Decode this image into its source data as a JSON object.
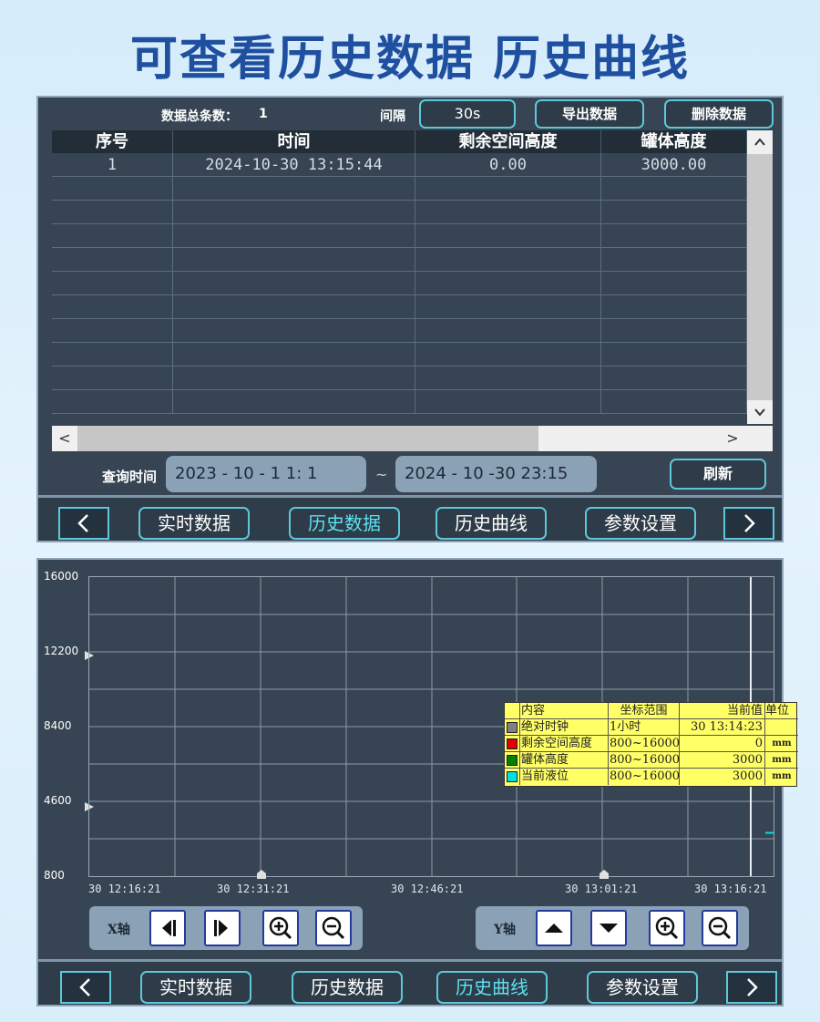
{
  "header": {
    "title": "可查看历史数据 历史曲线"
  },
  "table_panel": {
    "total_label": "数据总条数：",
    "total_value": "1",
    "interval_label": "间隔",
    "interval_value": "30s",
    "export_label": "导出数据",
    "delete_label": "删除数据",
    "columns": [
      "序号",
      "时间",
      "剩余空间高度",
      "罐体高度"
    ],
    "rows": [
      [
        "1",
        "2024-10-30  13:15:44",
        "0.00",
        "3000.00"
      ]
    ],
    "scroll_up": "▲",
    "scroll_down": "▼",
    "scroll_left": "<",
    "scroll_right": ">",
    "query_label": "查询时间",
    "query_start": "2023 - 10 - 1      1:  1",
    "query_tilde": "~",
    "query_end": "2024 - 10 -30    23:15",
    "refresh_label": "刷新"
  },
  "nav": {
    "prev": "<",
    "next": ">",
    "items": [
      "实时数据",
      "历史数据",
      "历史曲线",
      "参数设置"
    ]
  },
  "chart_panel": {
    "x_axis_label": "X轴",
    "y_axis_label": "Y轴",
    "legend": {
      "headers": [
        "内容",
        "坐标范围",
        "当前值",
        "单位"
      ],
      "rows": [
        {
          "name": "绝对时钟",
          "range": "1小时",
          "value": "30  13:14:23",
          "unit": "",
          "color": "#808080"
        },
        {
          "name": "剩余空间高度",
          "range": "800~16000",
          "value": "0",
          "unit": "mm",
          "color": "#e00000"
        },
        {
          "name": "罐体高度",
          "range": "800~16000",
          "value": "3000",
          "unit": "mm",
          "color": "#008000"
        },
        {
          "name": "当前液位",
          "range": "800~16000",
          "value": "3000",
          "unit": "mm",
          "color": "#00e0e0"
        }
      ]
    }
  },
  "chart_data": {
    "type": "line",
    "yticks": [
      "16000",
      "12200",
      "8400",
      "4600",
      "800"
    ],
    "xticks": [
      "30  12:16:21",
      "30  12:31:21",
      "30  12:46:21",
      "30  13:01:21",
      "30  13:16:21"
    ],
    "ylim": [
      800,
      16000
    ],
    "series": [
      {
        "name": "当前液位",
        "color": "#00e0e0",
        "values": [
          3000
        ]
      }
    ]
  },
  "colors": {
    "accent": "#5ec8d8",
    "panel": "#364453",
    "title": "#1f4f9f"
  }
}
